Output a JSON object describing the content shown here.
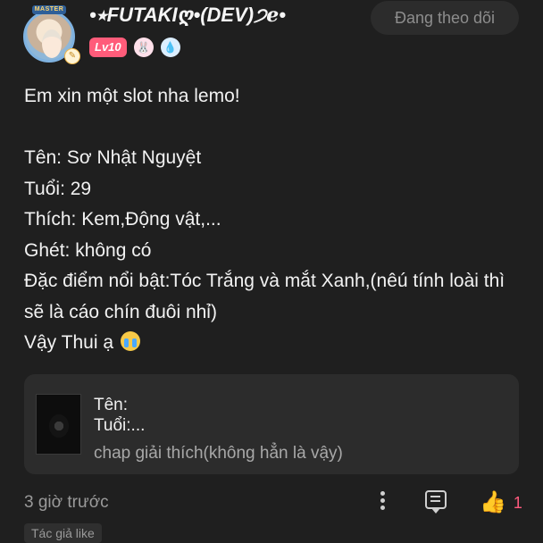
{
  "header": {
    "avatar_badge": "MASTER",
    "username": "•⭒FUTAKIღ•(DEV)੭ℯ•",
    "level": "Lv10",
    "follow_label": "Đang theo dõi"
  },
  "post": {
    "lines": [
      "Em xin một slot nha lemo!",
      "",
      "Tên: Sơ Nhật Nguyệt",
      "Tuổi: 29",
      "Thích: Kem,Động vật,...",
      "Ghét: không có",
      "Đặc điểm nổi bật:Tóc Trắng và mắt Xanh,(nêú tính loài thì sẽ là cáo chín đuôi nhỉ)",
      "Vậy Thui ạ"
    ]
  },
  "quote": {
    "line1": "Tên:",
    "line2": "Tuổi:...",
    "line3": "chap giải thích(không hẳn là vậy)"
  },
  "footer": {
    "time": "3 giờ trước",
    "like_count": "1",
    "tag": "Tác giả like"
  },
  "colors": {
    "background": "#1f1f1f",
    "accent_like": "#ff5a7d",
    "level_badge": "#ff5c7a"
  },
  "icons": [
    "more-vertical-icon",
    "comment-icon",
    "thumbs-up-icon",
    "crying-emoji-icon",
    "rabbit-badge-icon",
    "water-drop-badge-icon"
  ]
}
